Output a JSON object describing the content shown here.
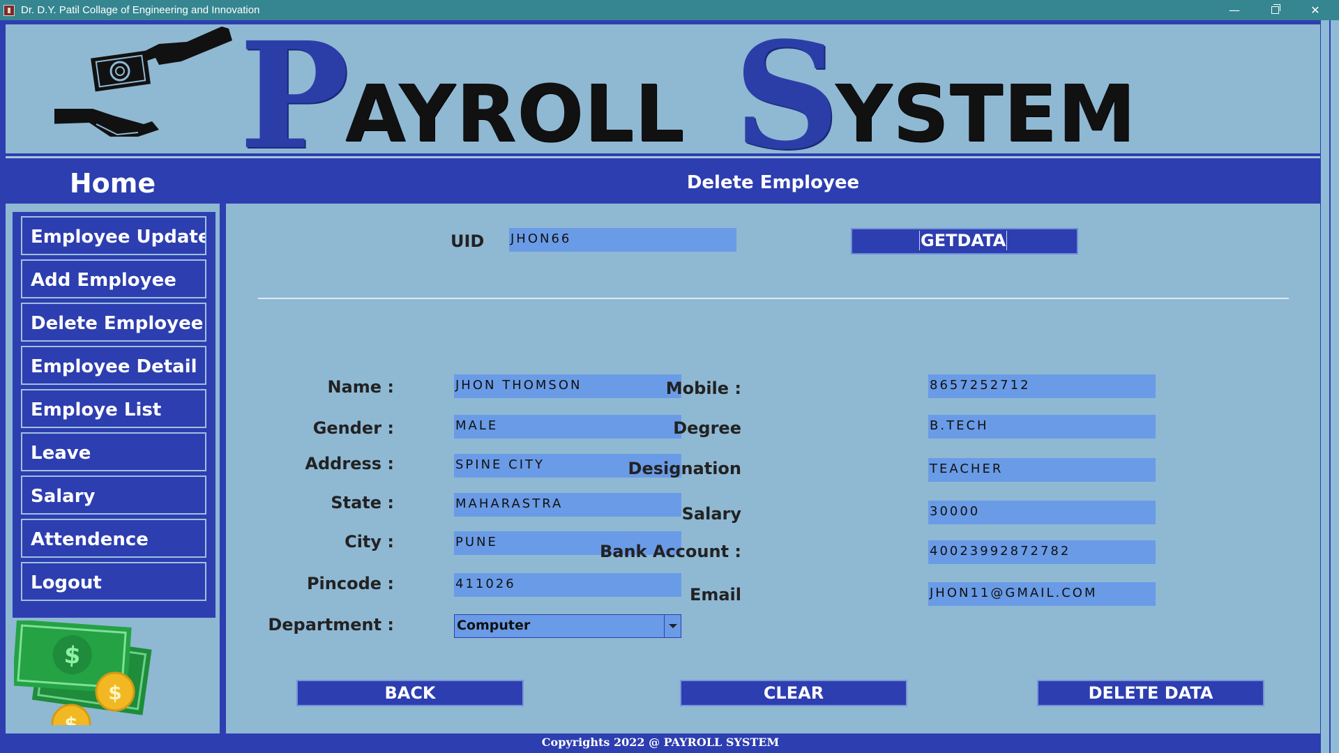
{
  "window": {
    "title": "Dr. D.Y. Patil Collage of Engineering and Innovation",
    "controls": {
      "minimize": "—",
      "close": "✕"
    }
  },
  "header": {
    "title_p": "P",
    "title_ayroll": "AYROLL",
    "title_s": "S",
    "title_ystem": "YSTEM"
  },
  "sidebar": {
    "home": "Home",
    "items": [
      {
        "label": "Employee Update"
      },
      {
        "label": "Add Employee"
      },
      {
        "label": "Delete Employee"
      },
      {
        "label": "Employee Detail"
      },
      {
        "label": "Employe List"
      },
      {
        "label": "Leave"
      },
      {
        "label": "Salary"
      },
      {
        "label": "Attendence"
      },
      {
        "label": "Logout"
      }
    ],
    "money_symbol": "$"
  },
  "main": {
    "heading": "Delete Employee",
    "uid_label": "UID",
    "uid_value": "JHON66",
    "getdata_label": "GETDATA",
    "left_fields": [
      {
        "label": "Name :",
        "value": "Jhon Thomson"
      },
      {
        "label": "Gender :",
        "value": "Male"
      },
      {
        "label": "Address :",
        "value": "Spine City"
      },
      {
        "label": "State :",
        "value": "Maharastra"
      },
      {
        "label": "City :",
        "value": "Pune"
      },
      {
        "label": "Pincode :",
        "value": "411026"
      }
    ],
    "department_label": "Department :",
    "department_value": "Computer",
    "right_fields": [
      {
        "label": "Mobile :",
        "value": "8657252712"
      },
      {
        "label": "Degree",
        "value": "B.Tech"
      },
      {
        "label": "Designation",
        "value": "Teacher"
      },
      {
        "label": "Salary",
        "value": "30000"
      },
      {
        "label": "Bank Account :",
        "value": "40023992872782"
      },
      {
        "label": "Email",
        "value": "jhon11@gmail.com"
      }
    ],
    "buttons": {
      "back": "BACK",
      "clear": "CLEAR",
      "delete": "DELETE DATA"
    }
  },
  "footer": "Copyrights 2022 @ PAYROLL SYSTEM"
}
